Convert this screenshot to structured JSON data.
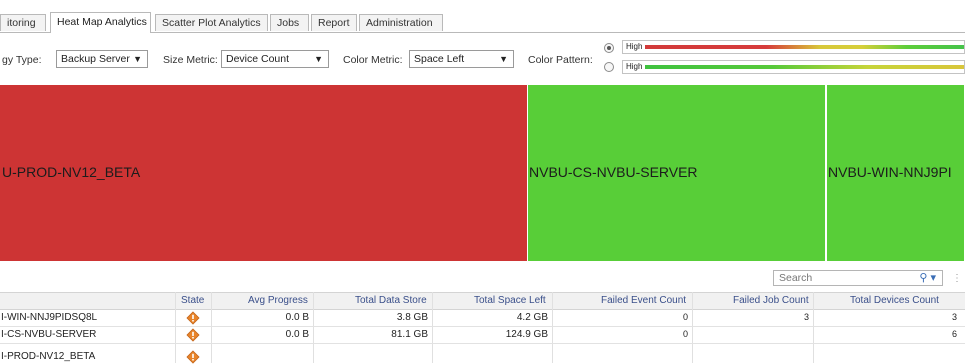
{
  "tabs": [
    {
      "label": "itoring",
      "active": false
    },
    {
      "label": "Heat Map Analytics",
      "active": true
    },
    {
      "label": "Scatter Plot Analytics",
      "active": false
    },
    {
      "label": "Jobs",
      "active": false
    },
    {
      "label": "Report",
      "active": false
    },
    {
      "label": "Administration",
      "active": false
    }
  ],
  "toolbar": {
    "topology_label": "gy Type:",
    "topology_value": "Backup Server",
    "size_label": "Size Metric:",
    "size_value": "Device Count",
    "color_label": "Color Metric:",
    "color_value": "Space Left",
    "pattern_label": "Color Pattern:",
    "patterns": [
      {
        "label": "High",
        "selected": true
      },
      {
        "label": "High",
        "selected": false
      }
    ]
  },
  "heatmap": [
    {
      "label": "U-PROD-NV12_BETA",
      "color": "#cd3434"
    },
    {
      "label": "NVBU-CS-NVBU-SERVER",
      "color": "#58ce38"
    },
    {
      "label": "NVBU-WIN-NNJ9PI",
      "color": "#58ce38"
    }
  ],
  "grid": {
    "search_placeholder": "Search",
    "columns": [
      "State",
      "Avg Progress",
      "Total Data Store",
      "Total Space Left",
      "Failed Event Count",
      "Failed Job Count",
      "Total Devices Count"
    ],
    "rows": [
      {
        "name": "I-WIN-NNJ9PIDSQ8L",
        "avg_progress": "0.0 B",
        "data_store": "3.8 GB",
        "space_left": "4.2 GB",
        "failed_events": "0",
        "failed_jobs": "3",
        "devices": "3"
      },
      {
        "name": "I-CS-NVBU-SERVER",
        "avg_progress": "0.0 B",
        "data_store": "81.1 GB",
        "space_left": "124.9 GB",
        "failed_events": "0",
        "failed_jobs": "",
        "devices": "6"
      },
      {
        "name": "I-PROD-NV12_BETA",
        "avg_progress": "",
        "data_store": "",
        "space_left": "",
        "failed_events": "",
        "failed_jobs": "",
        "devices": ""
      }
    ]
  },
  "colors": {
    "red": "#cd3434",
    "green": "#58ce38",
    "state_icon": "#e8842a"
  }
}
